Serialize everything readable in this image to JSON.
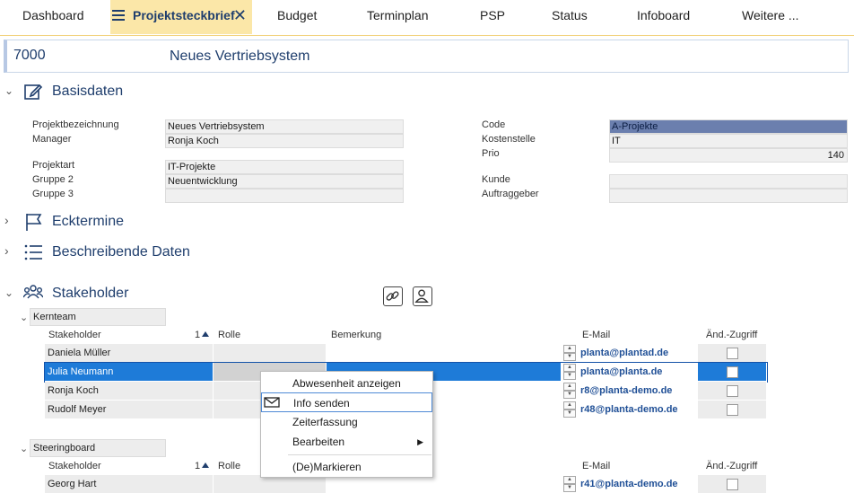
{
  "tabs": [
    {
      "label": "Dashboard"
    },
    {
      "label": "Projektsteckbrief"
    },
    {
      "label": "Budget"
    },
    {
      "label": "Terminplan"
    },
    {
      "label": "PSP"
    },
    {
      "label": "Status"
    },
    {
      "label": "Infoboard"
    },
    {
      "label": "Weitere ..."
    }
  ],
  "project": {
    "number": "7000",
    "name": "Neues Vertriebsystem"
  },
  "sections": {
    "basisdaten": "Basisdaten",
    "ecktermine": "Ecktermine",
    "beschreibende": "Beschreibende Daten",
    "stakeholder": "Stakeholder"
  },
  "form": {
    "projektbezeichnung": {
      "label": "Projektbezeichnung",
      "value": "Neues Vertriebsystem"
    },
    "manager": {
      "label": "Manager",
      "value": "Ronja Koch"
    },
    "projektart": {
      "label": "Projektart",
      "value": "IT-Projekte"
    },
    "gruppe2": {
      "label": "Gruppe 2",
      "value": "Neuentwicklung"
    },
    "gruppe3": {
      "label": "Gruppe 3",
      "value": ""
    },
    "code": {
      "label": "Code",
      "value": "A-Projekte"
    },
    "kostenstelle": {
      "label": "Kostenstelle",
      "value": "IT"
    },
    "prio": {
      "label": "Prio",
      "value": "140"
    },
    "kunde": {
      "label": "Kunde",
      "value": ""
    },
    "auftraggeber": {
      "label": "Auftraggeber",
      "value": ""
    }
  },
  "stakeholder": {
    "columns": {
      "stakeholder": "Stakeholder",
      "sort": "1",
      "rolle": "Rolle",
      "bemerkung": "Bemerkung",
      "email": "E-Mail",
      "zugriff": "Änd.-Zugriff"
    },
    "kernteam": {
      "label": "Kernteam",
      "rows": [
        {
          "name": "Daniela Müller",
          "email": "planta@plantad.de"
        },
        {
          "name": "Julia Neumann",
          "email": "planta@planta.de"
        },
        {
          "name": "Ronja Koch",
          "email": "r8@planta-demo.de"
        },
        {
          "name": "Rudolf Meyer",
          "email": "r48@planta-demo.de"
        }
      ]
    },
    "steeringboard": {
      "label": "Steeringboard",
      "rows": [
        {
          "name": "Georg Hart",
          "email": "r41@planta-demo.de"
        }
      ]
    }
  },
  "context_menu": {
    "items": [
      "Abwesenheit anzeigen",
      "Info senden",
      "Zeiterfassung",
      "Bearbeiten",
      "(De)Markieren"
    ]
  },
  "colors": {
    "accent": "#1f3e6d",
    "active_tab": "#fbe7a8",
    "selection": "#1e7bd8",
    "code_field": "#6b7fae"
  }
}
